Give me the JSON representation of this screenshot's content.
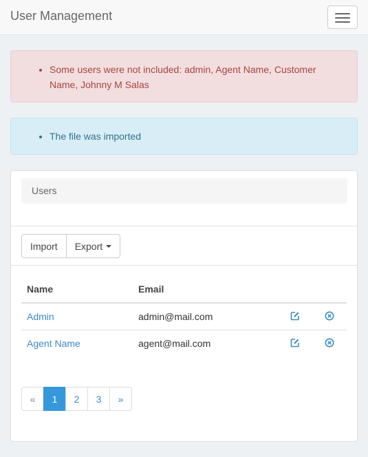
{
  "navbar": {
    "brand": "User Management"
  },
  "alerts": {
    "danger": "Some users were not included: admin, Agent Name, Customer Name, Johnny M Salas",
    "info": "The file was imported"
  },
  "panel": {
    "heading": "Users",
    "buttons": {
      "import": "Import",
      "export": "Export"
    },
    "table": {
      "headers": {
        "name": "Name",
        "email": "Email"
      },
      "rows": [
        {
          "name": "Admin",
          "email": "admin@mail.com"
        },
        {
          "name": "Agent Name",
          "email": "agent@mail.com"
        }
      ]
    },
    "pagination": {
      "prev": "«",
      "pages": [
        "1",
        "2",
        "3"
      ],
      "next": "»",
      "active": "1"
    }
  },
  "colors": {
    "accent": "#3498db",
    "link": "#3a8cc7",
    "danger_text": "#a94442",
    "info_text": "#31708f"
  },
  "icons": {
    "edit": "edit-icon",
    "delete": "delete-icon",
    "menu": "hamburger-icon"
  }
}
